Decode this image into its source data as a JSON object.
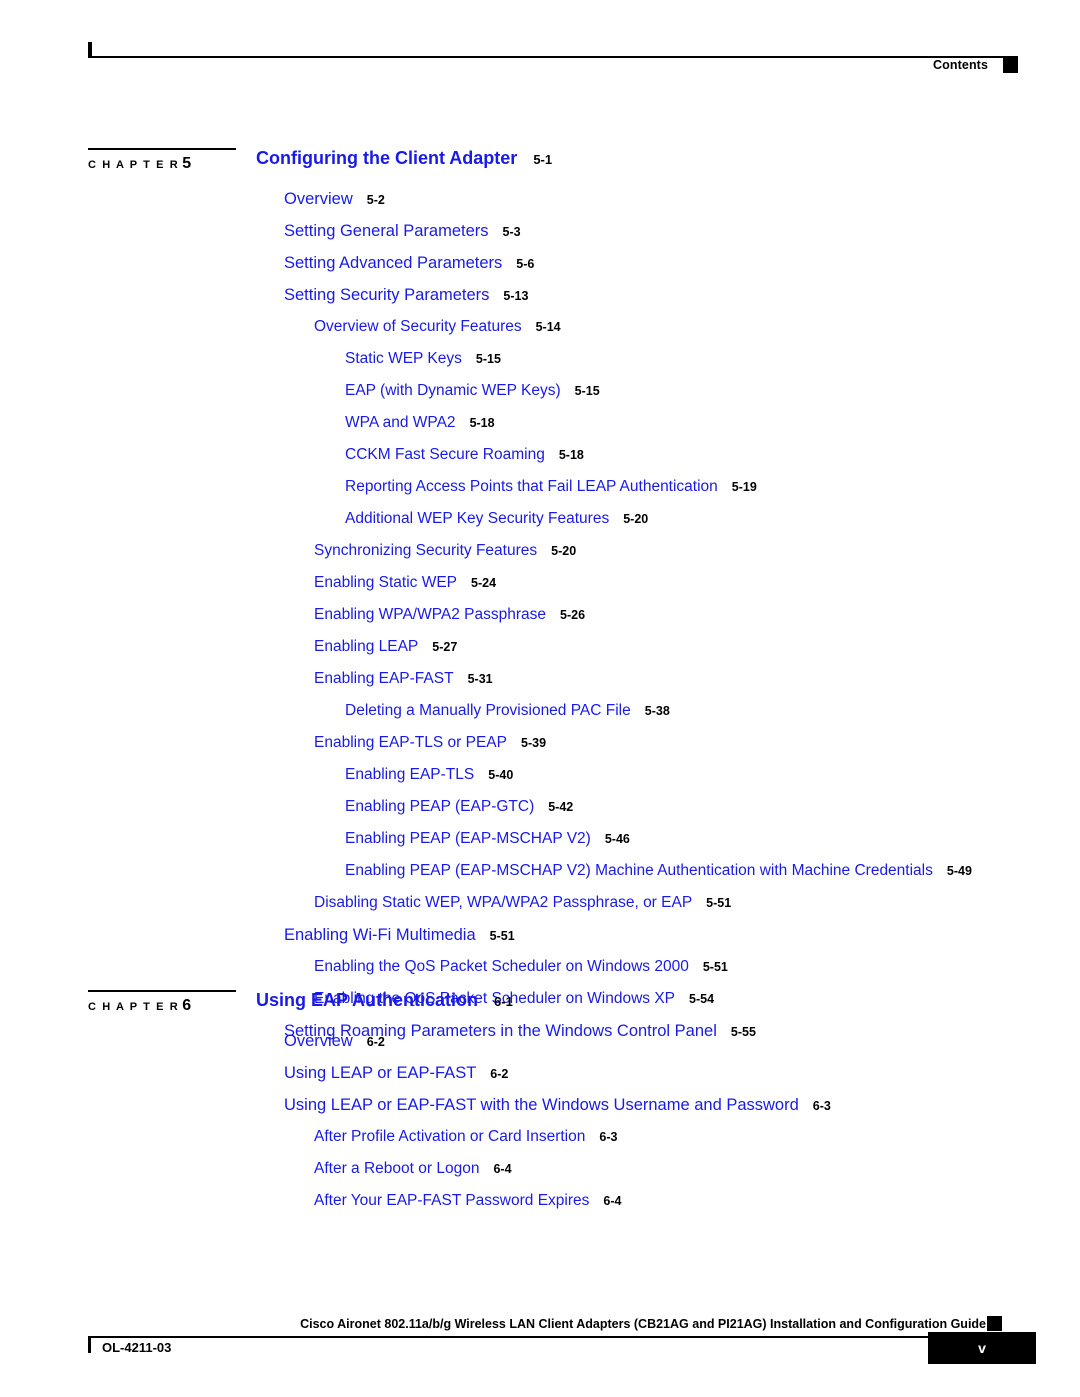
{
  "header": {
    "label": "Contents",
    "marker_icon": "black-square-marker"
  },
  "colors": {
    "link_blue": "#1a1ae8",
    "text_black": "#000000"
  },
  "chapters": [
    {
      "marker_label": "C H A P T E R",
      "marker_number": "5",
      "title": "Configuring the Client Adapter",
      "page": "5-1",
      "entries": [
        {
          "level": 1,
          "title": "Overview",
          "page": "5-2"
        },
        {
          "level": 1,
          "title": "Setting General Parameters",
          "page": "5-3"
        },
        {
          "level": 1,
          "title": "Setting Advanced Parameters",
          "page": "5-6"
        },
        {
          "level": 1,
          "title": "Setting Security Parameters",
          "page": "5-13"
        },
        {
          "level": 2,
          "title": "Overview of Security Features",
          "page": "5-14"
        },
        {
          "level": 3,
          "title": "Static WEP Keys",
          "page": "5-15"
        },
        {
          "level": 3,
          "title": "EAP (with Dynamic WEP Keys)",
          "page": "5-15"
        },
        {
          "level": 3,
          "title": "WPA and WPA2",
          "page": "5-18"
        },
        {
          "level": 3,
          "title": "CCKM Fast Secure Roaming",
          "page": "5-18"
        },
        {
          "level": 3,
          "title": "Reporting Access Points that Fail LEAP Authentication",
          "page": "5-19"
        },
        {
          "level": 3,
          "title": "Additional WEP Key Security Features",
          "page": "5-20"
        },
        {
          "level": 2,
          "title": "Synchronizing Security Features",
          "page": "5-20"
        },
        {
          "level": 2,
          "title": "Enabling Static WEP",
          "page": "5-24"
        },
        {
          "level": 2,
          "title": "Enabling WPA/WPA2 Passphrase",
          "page": "5-26"
        },
        {
          "level": 2,
          "title": "Enabling LEAP",
          "page": "5-27"
        },
        {
          "level": 2,
          "title": "Enabling EAP-FAST",
          "page": "5-31"
        },
        {
          "level": 3,
          "title": "Deleting a Manually Provisioned PAC File",
          "page": "5-38"
        },
        {
          "level": 2,
          "title": "Enabling EAP-TLS or PEAP",
          "page": "5-39"
        },
        {
          "level": 3,
          "title": "Enabling EAP-TLS",
          "page": "5-40"
        },
        {
          "level": 3,
          "title": "Enabling PEAP (EAP-GTC)",
          "page": "5-42"
        },
        {
          "level": 3,
          "title": "Enabling PEAP (EAP-MSCHAP V2)",
          "page": "5-46"
        },
        {
          "level": 3,
          "title": "Enabling PEAP (EAP-MSCHAP V2) Machine Authentication with Machine Credentials",
          "page": "5-49"
        },
        {
          "level": 2,
          "title": "Disabling Static WEP, WPA/WPA2 Passphrase, or EAP",
          "page": "5-51"
        },
        {
          "level": 1,
          "title": "Enabling Wi-Fi Multimedia",
          "page": "5-51"
        },
        {
          "level": 2,
          "title": "Enabling the QoS Packet Scheduler on Windows 2000",
          "page": "5-51"
        },
        {
          "level": 2,
          "title": "Enabling the QoS Packet Scheduler on Windows XP",
          "page": "5-54"
        },
        {
          "level": 1,
          "title": "Setting Roaming Parameters in the Windows Control Panel",
          "page": "5-55"
        }
      ]
    },
    {
      "marker_label": "C H A P T E R",
      "marker_number": "6",
      "title": "Using EAP Authentication",
      "page": "6-1",
      "entries": [
        {
          "level": 1,
          "title": "Overview",
          "page": "6-2"
        },
        {
          "level": 1,
          "title": "Using LEAP or EAP-FAST",
          "page": "6-2"
        },
        {
          "level": 1,
          "title": "Using LEAP or EAP-FAST with the Windows Username and Password",
          "page": "6-3"
        },
        {
          "level": 2,
          "title": "After Profile Activation or Card Insertion",
          "page": "6-3"
        },
        {
          "level": 2,
          "title": "After a Reboot or Logon",
          "page": "6-4"
        },
        {
          "level": 2,
          "title": "After Your EAP-FAST Password Expires",
          "page": "6-4"
        }
      ]
    }
  ],
  "footer": {
    "doc_title": "Cisco Aironet 802.11a/b/g Wireless LAN Client Adapters (CB21AG and PI21AG) Installation and Configuration Guide",
    "doc_id": "OL-4211-03",
    "page_number": "v",
    "marker_icon": "black-square-marker"
  }
}
